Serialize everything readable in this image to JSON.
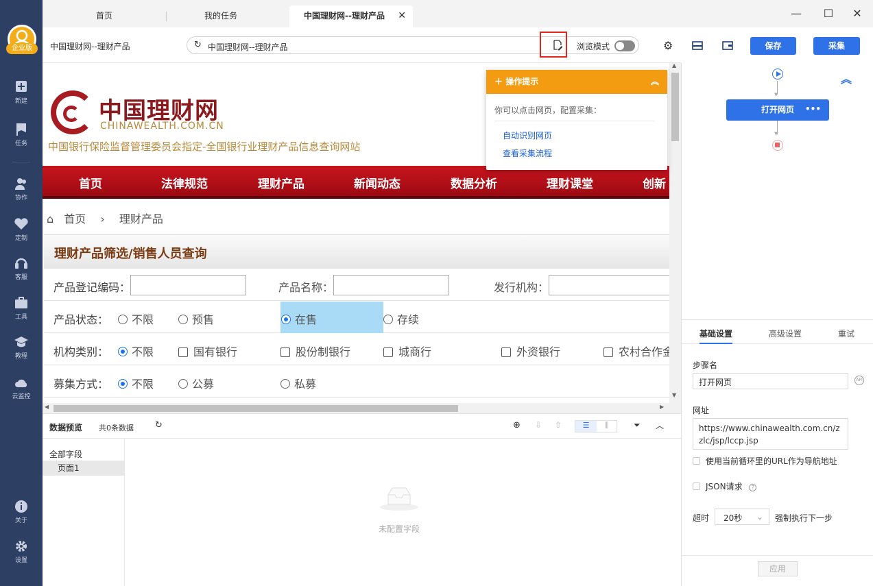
{
  "sidebar": {
    "badge": "企业版",
    "items": [
      {
        "label": "新建",
        "icon": "plus-square-icon"
      },
      {
        "label": "任务",
        "icon": "flag-check-icon"
      },
      {
        "label": "协作",
        "icon": "users-icon"
      },
      {
        "label": "定制",
        "icon": "heart-check-icon"
      },
      {
        "label": "客服",
        "icon": "headset-icon"
      },
      {
        "label": "工具",
        "icon": "toolbox-icon"
      },
      {
        "label": "教程",
        "icon": "graduation-cap-icon"
      },
      {
        "label": "云监控",
        "icon": "cloud-pulse-icon"
      }
    ],
    "bottom": [
      {
        "label": "关于",
        "icon": "info-icon"
      },
      {
        "label": "设置",
        "icon": "gear-icon"
      }
    ]
  },
  "tabs": [
    {
      "label": "首页"
    },
    {
      "label": "我的任务"
    },
    {
      "label": "中国理财网--理财产品",
      "active": true
    }
  ],
  "urlrow": {
    "page_title": "中国理财网--理财产品",
    "url_text": "中国理财网--理财产品",
    "browse_mode_label": "浏览模式",
    "save_label": "保存",
    "collect_label": "采集"
  },
  "site": {
    "logo_title": "中国理财网",
    "logo_domain": "CHINAWEALTH.COM.CN",
    "tagline": "中国银行保险监督管理委员会指定-全国银行业理财产品信息查询网站",
    "menu": [
      "首页",
      "法律规范",
      "理财产品",
      "新闻动态",
      "数据分析",
      "理财课堂",
      "创新"
    ],
    "breadcrumb_home": "首页",
    "breadcrumb_current": "理财产品",
    "filter_title": "理财产品筛选/销售人员查询",
    "row1": {
      "code_label": "产品登记编码：",
      "name_label": "产品名称：",
      "issuer_label": "发行机构："
    },
    "row2": {
      "label": "产品状态：",
      "options": [
        "不限",
        "预售",
        "在售",
        "存续"
      ],
      "selected": "在售"
    },
    "row3": {
      "label": "机构类别：",
      "options": [
        "不限",
        "国有银行",
        "股份制银行",
        "城商行",
        "外资银行",
        "农村合作金"
      ]
    },
    "row4": {
      "label": "募集方式：",
      "options": [
        "不限",
        "公募",
        "私募"
      ]
    }
  },
  "tip": {
    "title": "操作提示",
    "text": "你可以点击网页，配置采集：",
    "links": [
      "自动识别网页",
      "查看采集流程"
    ]
  },
  "preview": {
    "title": "数据预览",
    "count": "共0条数据",
    "all_fields": "全部字段",
    "page_item": "页面1",
    "empty_text": "未配置字段"
  },
  "flow": {
    "node_label": "打开网页",
    "more": "•••"
  },
  "settings": {
    "tabs": [
      "基础设置",
      "高级设置",
      "重试"
    ],
    "step_name_label": "步骤名",
    "step_name_value": "打开网页",
    "url_label": "网址",
    "url_value": "https://www.chinawealth.com.cn/zzlc/jsp/lccp.jsp",
    "use_loop_url": "使用当前循环里的URL作为导航地址",
    "json_request": "JSON请求",
    "timeout_label": "超时",
    "timeout_value": "20秒",
    "force_next": "强制执行下一步",
    "apply_label": "应用"
  }
}
